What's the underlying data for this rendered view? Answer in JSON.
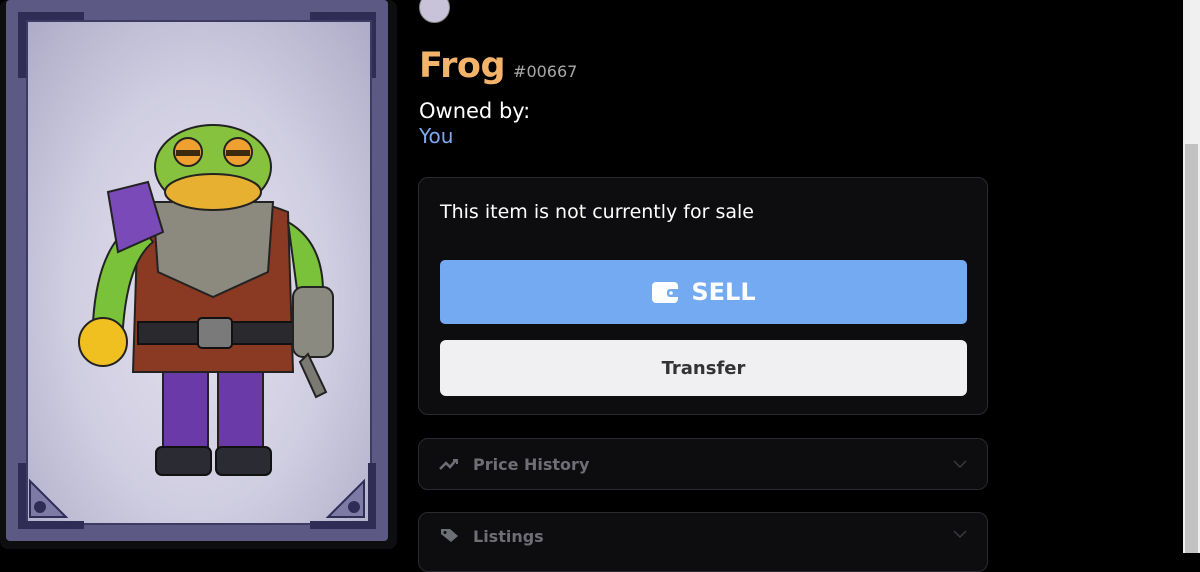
{
  "nft": {
    "name": "Frog",
    "token_id": "#00667",
    "owned_label": "Owned by:",
    "owner": "You"
  },
  "sale": {
    "status_text": "This item is not currently for sale",
    "sell_label": "SELL",
    "transfer_label": "Transfer"
  },
  "sections": {
    "price_history": "Price History",
    "listings": "Listings"
  },
  "colors": {
    "title": "#f4b36a",
    "owner_link": "#7eaaf2",
    "sell_button": "#74aaf2",
    "transfer_button": "#f0f0f2",
    "panel_bg": "#0d0d0f",
    "page_bg": "#000000"
  },
  "icons": {
    "sell": "wallet-icon",
    "price_history": "trend-line-icon",
    "listings": "tag-icon",
    "accordion": "chevron-down-icon"
  }
}
